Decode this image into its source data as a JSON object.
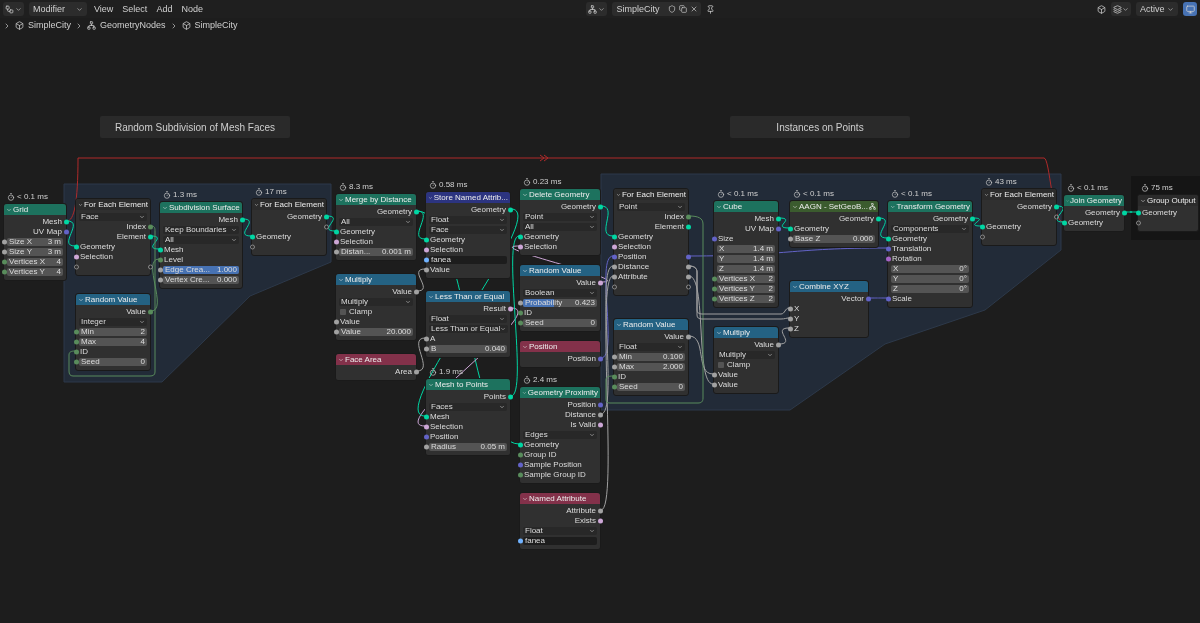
{
  "header": {
    "editor_menu": "Modifier",
    "menus": [
      "View",
      "Select",
      "Add",
      "Node"
    ],
    "node_tree": "SimpleCity",
    "mode": "Active"
  },
  "breadcrumbs": [
    "SimpleCity",
    "GeometryNodes",
    "SimpleCity"
  ],
  "frames": [
    {
      "label": "Random Subdivision of Mesh Faces"
    },
    {
      "label": "Instances on Points"
    }
  ],
  "nodes": [
    {
      "kind": "node",
      "title": "Grid",
      "timing": "< 0.1 ms",
      "color": "#1d725e",
      "rows": [
        {
          "kind": "output",
          "label": "Mesh",
          "color": "#00d6a3"
        },
        {
          "kind": "output",
          "label": "UV Map",
          "color": "#6363c7"
        },
        {
          "kind": "field",
          "label": "Size X",
          "value": "3 m",
          "color": "#a1a1a1"
        },
        {
          "kind": "field",
          "label": "Size Y",
          "value": "3 m",
          "color": "#a1a1a1"
        },
        {
          "kind": "field",
          "label": "Vertices X",
          "value": "4",
          "color": "#598c5c"
        },
        {
          "kind": "field",
          "label": "Vertices Y",
          "value": "4",
          "color": "#598c5c"
        }
      ]
    },
    {
      "kind": "node",
      "title": "For Each Element",
      "color": "#2b2b2b",
      "rows": [
        {
          "kind": "dropdown",
          "value": "Face"
        },
        {
          "kind": "output",
          "label": "Index",
          "color": "#598c5c"
        },
        {
          "kind": "output",
          "label": "Element",
          "color": "#00d6a3"
        },
        {
          "kind": "input",
          "label": "Geometry",
          "color": "#00d6a3"
        },
        {
          "kind": "input",
          "label": "Selection",
          "color": "#cca6d6"
        },
        {
          "kind": "emptyboth"
        }
      ]
    },
    {
      "kind": "node",
      "title": "Random Value",
      "color": "#246283",
      "rows": [
        {
          "kind": "output",
          "label": "Value",
          "color": "#598c5c"
        },
        {
          "kind": "dropdown",
          "value": "Integer"
        },
        {
          "kind": "field",
          "label": "Min",
          "value": "2",
          "color": "#598c5c"
        },
        {
          "kind": "field",
          "label": "Max",
          "value": "4",
          "color": "#598c5c"
        },
        {
          "kind": "input",
          "label": "ID",
          "color": "#598c5c"
        },
        {
          "kind": "field",
          "label": "Seed",
          "value": "0",
          "color": "#598c5c"
        }
      ]
    },
    {
      "kind": "node",
      "title": "Subdivision Surface",
      "timing": "1.3 ms",
      "color": "#1d725e",
      "rows": [
        {
          "kind": "output",
          "label": "Mesh",
          "color": "#00d6a3"
        },
        {
          "kind": "dropdown",
          "value": "Keep Boundaries"
        },
        {
          "kind": "dropdown",
          "value": "All"
        },
        {
          "kind": "input",
          "label": "Mesh",
          "color": "#00d6a3"
        },
        {
          "kind": "input",
          "label": "Level",
          "color": "#598c5c"
        },
        {
          "kind": "slider",
          "label": "Edge Crea...",
          "value": "1.000",
          "level": 1,
          "color": "#a1a1a1"
        },
        {
          "kind": "slider",
          "label": "Vertex Cre...",
          "value": "0.000",
          "level": 0,
          "color": "#a1a1a1"
        }
      ]
    },
    {
      "kind": "node",
      "title": "For Each Element",
      "timing": "17 ms",
      "color": "#2b2b2b",
      "rows": [
        {
          "kind": "output",
          "label": "Geometry",
          "color": "#00d6a3"
        },
        {
          "kind": "emptyout"
        },
        {
          "kind": "input",
          "label": "Geometry",
          "color": "#00d6a3"
        },
        {
          "kind": "emptyin"
        }
      ]
    },
    {
      "kind": "node",
      "title": "Merge by Distance",
      "timing": "8.3 ms",
      "color": "#1d725e",
      "rows": [
        {
          "kind": "output",
          "label": "Geometry",
          "color": "#00d6a3"
        },
        {
          "kind": "dropdown",
          "value": "All"
        },
        {
          "kind": "input",
          "label": "Geometry",
          "color": "#00d6a3"
        },
        {
          "kind": "input",
          "label": "Selection",
          "color": "#cca6d6"
        },
        {
          "kind": "field",
          "label": "Distan...",
          "value": "0.001 m",
          "color": "#a1a1a1"
        }
      ]
    },
    {
      "kind": "node",
      "title": "Store Named Attrib...",
      "timing": "0.58 ms",
      "color": "#2c3480",
      "rows": [
        {
          "kind": "output",
          "label": "Geometry",
          "color": "#00d6a3"
        },
        {
          "kind": "dropdown",
          "value": "Float"
        },
        {
          "kind": "dropdown",
          "value": "Face"
        },
        {
          "kind": "input",
          "label": "Geometry",
          "color": "#00d6a3"
        },
        {
          "kind": "input",
          "label": "Selection",
          "color": "#cca6d6"
        },
        {
          "kind": "text",
          "value": "fanea",
          "color": "#70b2ff"
        },
        {
          "kind": "input",
          "label": "Value",
          "color": "#a1a1a1"
        }
      ]
    },
    {
      "kind": "node",
      "title": "Multiply",
      "color": "#246283",
      "rows": [
        {
          "kind": "output",
          "label": "Value",
          "color": "#a1a1a1"
        },
        {
          "kind": "dropdown",
          "value": "Multiply"
        },
        {
          "kind": "check",
          "label": "Clamp",
          "checked": false
        },
        {
          "kind": "input",
          "label": "Value",
          "color": "#a1a1a1"
        },
        {
          "kind": "field",
          "label": "Value",
          "value": "20.000",
          "color": "#a1a1a1"
        }
      ]
    },
    {
      "kind": "node",
      "title": "Less Than or Equal",
      "color": "#246283",
      "rows": [
        {
          "kind": "output",
          "label": "Result",
          "color": "#cca6d6"
        },
        {
          "kind": "dropdown",
          "value": "Float"
        },
        {
          "kind": "dropdown",
          "value": "Less Than or Equal"
        },
        {
          "kind": "input",
          "label": "A",
          "color": "#a1a1a1"
        },
        {
          "kind": "field",
          "label": "B",
          "value": "0.040",
          "color": "#a1a1a1"
        }
      ]
    },
    {
      "kind": "node",
      "title": "Face Area",
      "color": "#83314a",
      "rows": [
        {
          "kind": "output",
          "label": "Area",
          "color": "#a1a1a1"
        }
      ]
    },
    {
      "kind": "node",
      "title": "Mesh to Points",
      "timing": "1.9 ms",
      "color": "#1d725e",
      "rows": [
        {
          "kind": "output",
          "label": "Points",
          "color": "#00d6a3"
        },
        {
          "kind": "dropdown",
          "value": "Faces"
        },
        {
          "kind": "input",
          "label": "Mesh",
          "color": "#00d6a3"
        },
        {
          "kind": "input",
          "label": "Selection",
          "color": "#cca6d6"
        },
        {
          "kind": "input",
          "label": "Position",
          "color": "#6363c7"
        },
        {
          "kind": "field",
          "label": "Radius",
          "value": "0.05 m",
          "color": "#a1a1a1"
        }
      ]
    },
    {
      "kind": "node",
      "title": "Delete Geometry",
      "timing": "0.23 ms",
      "color": "#1d725e",
      "rows": [
        {
          "kind": "output",
          "label": "Geometry",
          "color": "#00d6a3"
        },
        {
          "kind": "dropdown",
          "value": "Point"
        },
        {
          "kind": "dropdown",
          "value": "All"
        },
        {
          "kind": "input",
          "label": "Geometry",
          "color": "#00d6a3"
        },
        {
          "kind": "input",
          "label": "Selection",
          "color": "#cca6d6"
        }
      ]
    },
    {
      "kind": "node",
      "title": "Random Value",
      "color": "#246283",
      "rows": [
        {
          "kind": "output",
          "label": "Value",
          "color": "#cca6d6"
        },
        {
          "kind": "dropdown",
          "value": "Boolean"
        },
        {
          "kind": "slider",
          "label": "Probability",
          "value": "0.423",
          "level": 0.423,
          "color": "#a1a1a1"
        },
        {
          "kind": "input",
          "label": "ID",
          "color": "#598c5c"
        },
        {
          "kind": "field",
          "label": "Seed",
          "value": "0",
          "color": "#598c5c"
        }
      ]
    },
    {
      "kind": "node",
      "title": "Position",
      "color": "#83314a",
      "rows": [
        {
          "kind": "output",
          "label": "Position",
          "color": "#6363c7"
        }
      ]
    },
    {
      "kind": "node",
      "title": "Geometry Proximity",
      "timing": "2.4 ms",
      "color": "#1d725e",
      "rows": [
        {
          "kind": "output",
          "label": "Position",
          "color": "#6363c7"
        },
        {
          "kind": "output",
          "label": "Distance",
          "color": "#a1a1a1"
        },
        {
          "kind": "output",
          "label": "Is Valid",
          "color": "#cca6d6"
        },
        {
          "kind": "dropdown",
          "value": "Edges"
        },
        {
          "kind": "input",
          "label": "Geometry",
          "color": "#00d6a3"
        },
        {
          "kind": "input",
          "label": "Group ID",
          "color": "#598c5c"
        },
        {
          "kind": "input",
          "label": "Sample Position",
          "color": "#6363c7"
        },
        {
          "kind": "input",
          "label": "Sample Group ID",
          "color": "#598c5c"
        }
      ]
    },
    {
      "kind": "node",
      "title": "Named Attribute",
      "color": "#83314a",
      "rows": [
        {
          "kind": "output",
          "label": "Attribute",
          "color": "#a1a1a1"
        },
        {
          "kind": "output",
          "label": "Exists",
          "color": "#cca6d6"
        },
        {
          "kind": "dropdown",
          "value": "Float"
        },
        {
          "kind": "text",
          "value": "fanea",
          "color": "#70b2ff"
        }
      ]
    },
    {
      "kind": "node",
      "title": "For Each Element",
      "color": "#2b2b2b",
      "rows": [
        {
          "kind": "dropdown",
          "value": "Point"
        },
        {
          "kind": "output",
          "label": "Index",
          "color": "#598c5c"
        },
        {
          "kind": "output",
          "label": "Element",
          "color": "#00d6a3"
        },
        {
          "kind": "input",
          "label": "Geometry",
          "color": "#00d6a3"
        },
        {
          "kind": "input",
          "label": "Selection",
          "color": "#cca6d6"
        },
        {
          "kind": "both",
          "label": "Position",
          "color": "#6363c7"
        },
        {
          "kind": "both",
          "label": "Distance",
          "color": "#a1a1a1"
        },
        {
          "kind": "both",
          "label": "Attribute",
          "color": "#a1a1a1"
        },
        {
          "kind": "emptyboth"
        }
      ]
    },
    {
      "kind": "node",
      "title": "Cube",
      "timing": "< 0.1 ms",
      "color": "#1d725e",
      "rows": [
        {
          "kind": "output",
          "label": "Mesh",
          "color": "#00d6a3"
        },
        {
          "kind": "output",
          "label": "UV Map",
          "color": "#6363c7"
        },
        {
          "kind": "input",
          "label": "Size",
          "color": "#6363c7"
        },
        {
          "kind": "subfield",
          "label": "X",
          "value": "1.4 m"
        },
        {
          "kind": "subfield",
          "label": "Y",
          "value": "1.4 m"
        },
        {
          "kind": "subfield",
          "label": "Z",
          "value": "1.4 m"
        },
        {
          "kind": "field",
          "label": "Vertices X",
          "value": "2",
          "color": "#598c5c"
        },
        {
          "kind": "field",
          "label": "Vertices Y",
          "value": "2",
          "color": "#598c5c"
        },
        {
          "kind": "field",
          "label": "Vertices Z",
          "value": "2",
          "color": "#598c5c"
        }
      ]
    },
    {
      "kind": "group",
      "title": "AAGN - SetGeoB...",
      "timing": "< 0.1 ms",
      "color": "#3b5b2e",
      "rows": [
        {
          "kind": "output",
          "label": "Geometry",
          "color": "#00d6a3"
        },
        {
          "kind": "input",
          "label": "Geometry",
          "color": "#00d6a3"
        },
        {
          "kind": "field",
          "label": "Base Z",
          "value": "0.000",
          "color": "#a1a1a1"
        }
      ]
    },
    {
      "kind": "node",
      "title": "Transform Geometry",
      "timing": "< 0.1 ms",
      "color": "#1d725e",
      "rows": [
        {
          "kind": "output",
          "label": "Geometry",
          "color": "#00d6a3"
        },
        {
          "kind": "dropdown",
          "value": "Components"
        },
        {
          "kind": "input",
          "label": "Geometry",
          "color": "#00d6a3"
        },
        {
          "kind": "input",
          "label": "Translation",
          "color": "#6363c7"
        },
        {
          "kind": "input",
          "label": "Rotation",
          "color": "#a663c7"
        },
        {
          "kind": "subfield",
          "label": "X",
          "value": "0°"
        },
        {
          "kind": "subfield",
          "label": "Y",
          "value": "0°"
        },
        {
          "kind": "subfield",
          "label": "Z",
          "value": "0°"
        },
        {
          "kind": "input",
          "label": "Scale",
          "color": "#6363c7"
        }
      ]
    },
    {
      "kind": "node",
      "title": "Combine XYZ",
      "color": "#246283",
      "rows": [
        {
          "kind": "output",
          "label": "Vector",
          "color": "#6363c7"
        },
        {
          "kind": "input",
          "label": "X",
          "color": "#a1a1a1"
        },
        {
          "kind": "input",
          "label": "Y",
          "color": "#a1a1a1"
        },
        {
          "kind": "input",
          "label": "Z",
          "color": "#a1a1a1"
        }
      ]
    },
    {
      "kind": "node",
      "title": "Random Value",
      "color": "#246283",
      "rows": [
        {
          "kind": "output",
          "label": "Value",
          "color": "#a1a1a1"
        },
        {
          "kind": "dropdown",
          "value": "Float"
        },
        {
          "kind": "field",
          "label": "Min",
          "value": "0.100",
          "color": "#a1a1a1"
        },
        {
          "kind": "field",
          "label": "Max",
          "value": "2.000",
          "color": "#a1a1a1"
        },
        {
          "kind": "input",
          "label": "ID",
          "color": "#598c5c"
        },
        {
          "kind": "field",
          "label": "Seed",
          "value": "0",
          "color": "#598c5c"
        }
      ]
    },
    {
      "kind": "node",
      "title": "Multiply",
      "color": "#246283",
      "rows": [
        {
          "kind": "output",
          "label": "Value",
          "color": "#a1a1a1"
        },
        {
          "kind": "dropdown",
          "value": "Multiply"
        },
        {
          "kind": "check",
          "label": "Clamp",
          "checked": false
        },
        {
          "kind": "input",
          "label": "Value",
          "color": "#a1a1a1"
        },
        {
          "kind": "input",
          "label": "Value",
          "color": "#a1a1a1"
        }
      ]
    },
    {
      "kind": "node",
      "title": "For Each Element",
      "timing": "43 ms",
      "color": "#2b2b2b",
      "rows": [
        {
          "kind": "output",
          "label": "Geometry",
          "color": "#00d6a3"
        },
        {
          "kind": "emptyout"
        },
        {
          "kind": "input",
          "label": "Geometry",
          "color": "#00d6a3"
        },
        {
          "kind": "emptyin"
        }
      ]
    },
    {
      "kind": "node",
      "title": "Join Geometry",
      "timing": "< 0.1 ms",
      "color": "#1d725e",
      "rows": [
        {
          "kind": "output",
          "label": "Geometry",
          "color": "#00d6a3"
        },
        {
          "kind": "input",
          "label": "Geometry",
          "color": "#00d6a3"
        }
      ]
    },
    {
      "kind": "node",
      "title": "Group Output",
      "timing": "75 ms",
      "color": "#2b2b2b",
      "rows": [
        {
          "kind": "input",
          "label": "Geometry",
          "color": "#00d6a3"
        },
        {
          "kind": "emptyin"
        }
      ]
    }
  ]
}
